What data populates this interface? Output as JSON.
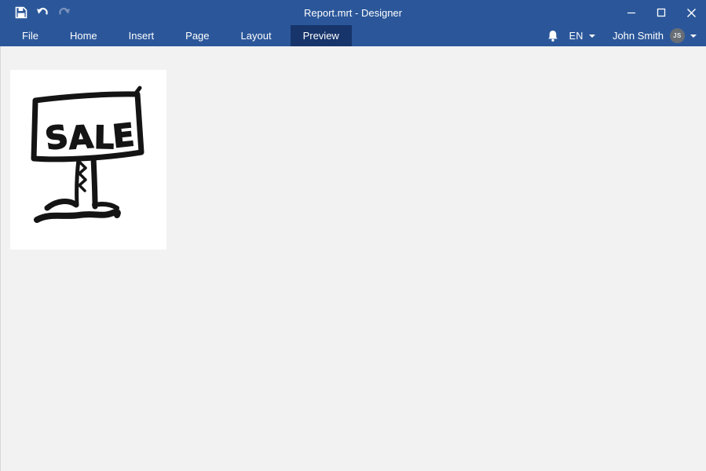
{
  "titlebar": {
    "title": "Report.mrt - Designer",
    "quick_actions": [
      {
        "name": "save",
        "icon": "floppy-disk"
      },
      {
        "name": "undo",
        "icon": "arrow-curve-left"
      },
      {
        "name": "redo",
        "icon": "arrow-curve-right",
        "disabled": true
      }
    ],
    "window_controls": [
      "minimize",
      "maximize",
      "close"
    ]
  },
  "ribbon": {
    "tabs": [
      {
        "label": "File",
        "active": false
      },
      {
        "label": "Home",
        "active": false
      },
      {
        "label": "Insert",
        "active": false
      },
      {
        "label": "Page",
        "active": false
      },
      {
        "label": "Layout",
        "active": false
      },
      {
        "label": "Preview",
        "active": true
      }
    ],
    "right": {
      "notifications_icon": "bell",
      "language": "EN",
      "user_name": "John Smith",
      "user_initials": "JS"
    }
  },
  "preview_toolbar": {
    "icons": [
      {
        "name": "refresh",
        "color": "#4a7ab8"
      },
      {
        "name": "open-folder",
        "color": "#7a7a7a"
      },
      {
        "name": "edit-pencil",
        "color": "#4a7ab8"
      },
      {
        "name": "open-new-window",
        "color": "#7a7a7a"
      },
      {
        "name": "more-options",
        "color": "#7a7a7a"
      }
    ]
  },
  "canvas": {
    "page": {
      "sign_text": "SALE",
      "description": "hand-drawn sale sign doodle on white report page"
    }
  },
  "colors": {
    "titlebar_blue": "#2b579a",
    "active_tab_blue": "#17356b",
    "canvas_gray": "#f2f2f2",
    "icon_steel_blue": "#4a7ab8",
    "icon_gray": "#7a7a7a",
    "doodle_ink": "#141414"
  }
}
